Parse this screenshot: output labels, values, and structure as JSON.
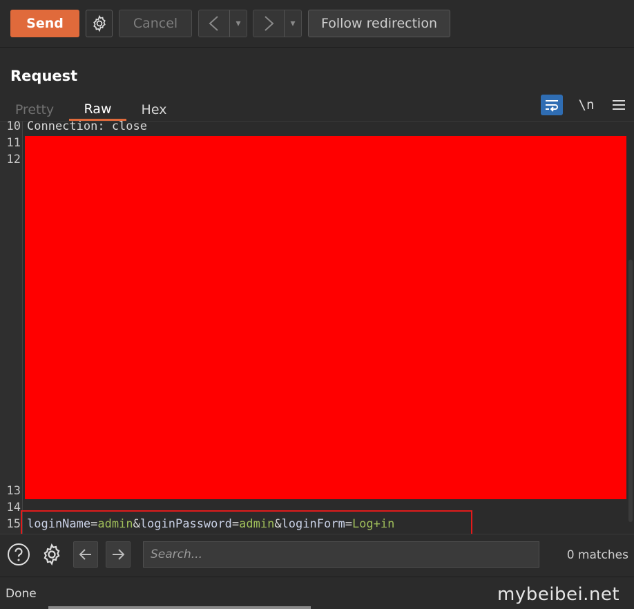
{
  "toolbar": {
    "send_label": "Send",
    "cancel_label": "Cancel",
    "back_glyph": "<",
    "forward_glyph": ">",
    "dropdown_glyph": "▾",
    "follow_label": "Follow redirection"
  },
  "request": {
    "title": "Request",
    "tabs": [
      {
        "label": "Pretty",
        "active": false
      },
      {
        "label": "Raw",
        "active": true
      },
      {
        "label": "Hex",
        "active": false
      }
    ],
    "newline_toggle_label": "\\n"
  },
  "editor": {
    "line_numbers": [
      "10",
      "11",
      "12",
      "13",
      "14",
      "15"
    ],
    "line_10": "Connection: close",
    "body": {
      "k1": "loginName",
      "eq1": "=",
      "v1": "admin",
      "amp1": "&",
      "k2": "loginPassword",
      "eq2": "=",
      "v2": "admin",
      "amp2": "&",
      "k3": "loginForm",
      "eq3": "=",
      "v3": "Log+in"
    },
    "colors": {
      "redaction": "#ff0000",
      "highlight_border": "#e31b1b",
      "param_key": "#c9d1e6",
      "param_value": "#9fbe5a"
    }
  },
  "search": {
    "placeholder": "Search...",
    "value": "",
    "matches": "0 matches"
  },
  "status": {
    "text": "Done"
  },
  "watermark": "mybeibei.net",
  "accent_color": "#e06a3b"
}
